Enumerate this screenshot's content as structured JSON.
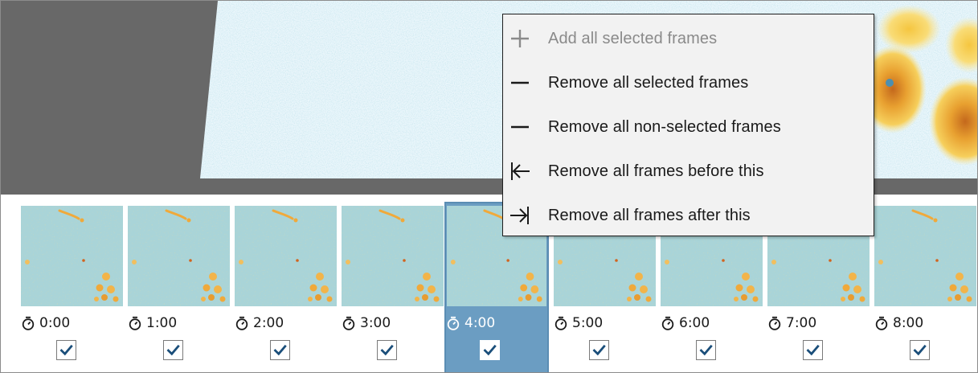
{
  "preview": {
    "icon": "recorded-screen-preview"
  },
  "frames": [
    {
      "duration": "0:00",
      "checked": true,
      "selected": false
    },
    {
      "duration": "1:00",
      "checked": true,
      "selected": false
    },
    {
      "duration": "2:00",
      "checked": true,
      "selected": false
    },
    {
      "duration": "3:00",
      "checked": true,
      "selected": false
    },
    {
      "duration": "4:00",
      "checked": true,
      "selected": true
    },
    {
      "duration": "5:00",
      "checked": true,
      "selected": false
    },
    {
      "duration": "6:00",
      "checked": true,
      "selected": false
    },
    {
      "duration": "7:00",
      "checked": true,
      "selected": false
    },
    {
      "duration": "8:00",
      "checked": true,
      "selected": false
    }
  ],
  "context_menu": {
    "items": [
      {
        "label": "Add all selected frames",
        "icon": "plus-icon",
        "enabled": false
      },
      {
        "label": "Remove all selected frames",
        "icon": "minus-icon",
        "enabled": true
      },
      {
        "label": "Remove all non-selected frames",
        "icon": "minus-icon",
        "enabled": true
      },
      {
        "label": "Remove all frames before this",
        "icon": "arrow-left-to-bar-icon",
        "enabled": true
      },
      {
        "label": "Remove all frames after this",
        "icon": "arrow-right-to-bar-icon",
        "enabled": true
      }
    ]
  },
  "colors": {
    "preview_background": "#686868",
    "selection": "#6b9dc2",
    "thumbnail_background": "#a9d4d8",
    "accent_orange": "#f0a93a",
    "menu_background": "#f2f2f2",
    "check_mark": "#1a4e7a"
  }
}
